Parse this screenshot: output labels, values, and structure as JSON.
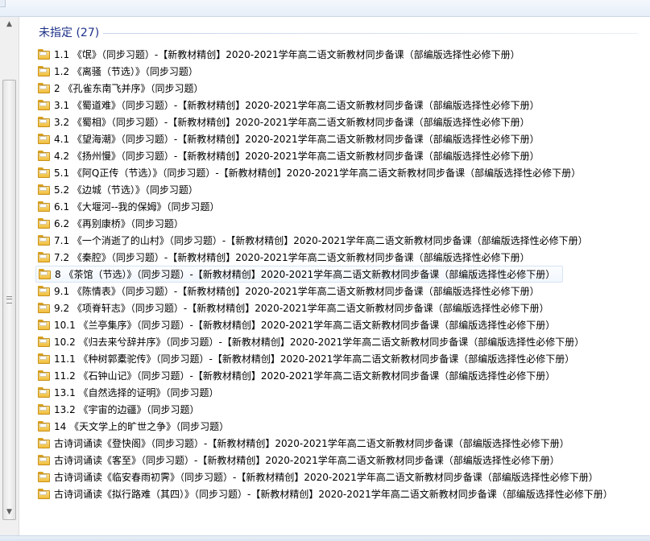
{
  "group": {
    "title": "未指定 (27)"
  },
  "items": [
    {
      "label": "1.1 《氓》（同步习题）-【新教材精创】2020-2021学年高二语文新教材同步备课（部编版选择性必修下册）"
    },
    {
      "label": "1.2 《离骚（节选）》（同步习题）"
    },
    {
      "label": "2 《孔雀东南飞并序》（同步习题）"
    },
    {
      "label": "3.1 《蜀道难》（同步习题）-【新教材精创】2020-2021学年高二语文新教材同步备课（部编版选择性必修下册）"
    },
    {
      "label": "3.2 《蜀相》（同步习题）-【新教材精创】2020-2021学年高二语文新教材同步备课（部编版选择性必修下册）"
    },
    {
      "label": "4.1 《望海潮》（同步习题）-【新教材精创】2020-2021学年高二语文新教材同步备课（部编版选择性必修下册）"
    },
    {
      "label": "4.2 《扬州慢》（同步习题）-【新教材精创】2020-2021学年高二语文新教材同步备课（部编版选择性必修下册）"
    },
    {
      "label": "5.1 《阿Q正传（节选）》（同步习题）-【新教材精创】2020-2021学年高二语文新教材同步备课（部编版选择性必修下册）"
    },
    {
      "label": "5.2 《边城（节选）》（同步习题）"
    },
    {
      "label": "6.1 《大堰河--我的保姆》（同步习题）"
    },
    {
      "label": "6.2 《再别康桥》（同步习题）"
    },
    {
      "label": "7.1 《一个消逝了的山村》（同步习题）-【新教材精创】2020-2021学年高二语文新教材同步备课（部编版选择性必修下册）"
    },
    {
      "label": "7.2 《秦腔》（同步习题）-【新教材精创】2020-2021学年高二语文新教材同步备课（部编版选择性必修下册）"
    },
    {
      "label": "8 《茶馆（节选）》（同步习题）-【新教材精创】2020-2021学年高二语文新教材同步备课（部编版选择性必修下册）"
    },
    {
      "label": "9.1 《陈情表》（同步习题）-【新教材精创】2020-2021学年高二语文新教材同步备课（部编版选择性必修下册）"
    },
    {
      "label": "9.2 《项脊轩志》（同步习题）-【新教材精创】2020-2021学年高二语文新教材同步备课（部编版选择性必修下册）"
    },
    {
      "label": "10.1 《兰亭集序》（同步习题）-【新教材精创】2020-2021学年高二语文新教材同步备课（部编版选择性必修下册）"
    },
    {
      "label": "10.2 《归去来兮辞并序》（同步习题）-【新教材精创】2020-2021学年高二语文新教材同步备课（部编版选择性必修下册）"
    },
    {
      "label": "11.1 《种树郭橐驼传》（同步习题）-【新教材精创】2020-2021学年高二语文新教材同步备课（部编版选择性必修下册）"
    },
    {
      "label": "11.2 《石钟山记》（同步习题）-【新教材精创】2020-2021学年高二语文新教材同步备课（部编版选择性必修下册）"
    },
    {
      "label": "13.1 《自然选择的证明》（同步习题）"
    },
    {
      "label": "13.2 《宇宙的边疆》（同步习题）"
    },
    {
      "label": "14 《天文学上的旷世之争》（同步习题）"
    },
    {
      "label": "古诗词诵读《登快阁》（同步习题）-【新教材精创】2020-2021学年高二语文新教材同步备课（部编版选择性必修下册）"
    },
    {
      "label": "古诗词诵读《客至》（同步习题）-【新教材精创】2020-2021学年高二语文新教材同步备课（部编版选择性必修下册）"
    },
    {
      "label": "古诗词诵读《临安春雨初霁》（同步习题）-【新教材精创】2020-2021学年高二语文新教材同步备课（部编版选择性必修下册）"
    },
    {
      "label": "古诗词诵读《拟行路难（其四）》（同步习题）-【新教材精创】2020-2021学年高二语文新教材同步备课（部编版选择性必修下册）"
    }
  ],
  "selected_index": 13,
  "icons": {
    "item": "folder-icon",
    "scroll_up": "arrow-up-icon",
    "scroll_down": "arrow-down-icon"
  },
  "colors": {
    "group_title": "#1e3287",
    "selection_border": "#d7e4f5",
    "folder": "#f0bd3c"
  }
}
